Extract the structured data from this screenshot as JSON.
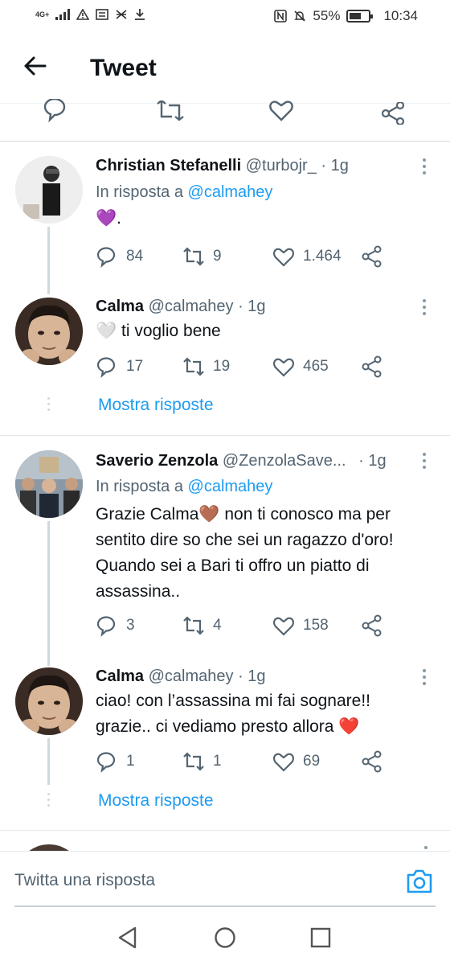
{
  "status_bar": {
    "network": "4G+",
    "battery": "55%",
    "time": "10:34"
  },
  "header": {
    "title": "Tweet"
  },
  "tweets": [
    {
      "name": "Christian Stefanelli",
      "handle": "@turbojr_",
      "time": "· 1g",
      "reply_prefix": "In risposta a ",
      "reply_to": "@calmahey",
      "text": "💜.",
      "replies": "84",
      "retweets": "9",
      "likes": "1.464"
    },
    {
      "name": "Calma",
      "handle": "@calmahey",
      "time": "· 1g",
      "text": "🤍 ti voglio bene",
      "replies": "17",
      "retweets": "19",
      "likes": "465",
      "show_replies": "Mostra risposte"
    },
    {
      "name": "Saverio Zenzola",
      "handle": "@ZenzolaSave...",
      "time": "· 1g",
      "reply_prefix": "In risposta a ",
      "reply_to": "@calmahey",
      "text": "Grazie Calma🤎 non ti conosco ma per sentito dire so che sei un ragazzo d'oro! Quando sei a Bari ti offro un piatto di assassina..",
      "replies": "3",
      "retweets": "4",
      "likes": "158"
    },
    {
      "name": "Calma",
      "handle": "@calmahey",
      "time": "· 1g",
      "text": "ciao! con l’assassina mi fai sognare!! grazie.. ci vediamo presto allora ❤️",
      "replies": "1",
      "retweets": "1",
      "likes": "69",
      "show_replies": "Mostra risposte"
    }
  ],
  "reply_bar": {
    "placeholder": "Twitta una risposta"
  },
  "colors": {
    "accent": "#1d9bf0",
    "text": "#0f1419",
    "secondary": "#536471",
    "line": "#cfd9de"
  }
}
